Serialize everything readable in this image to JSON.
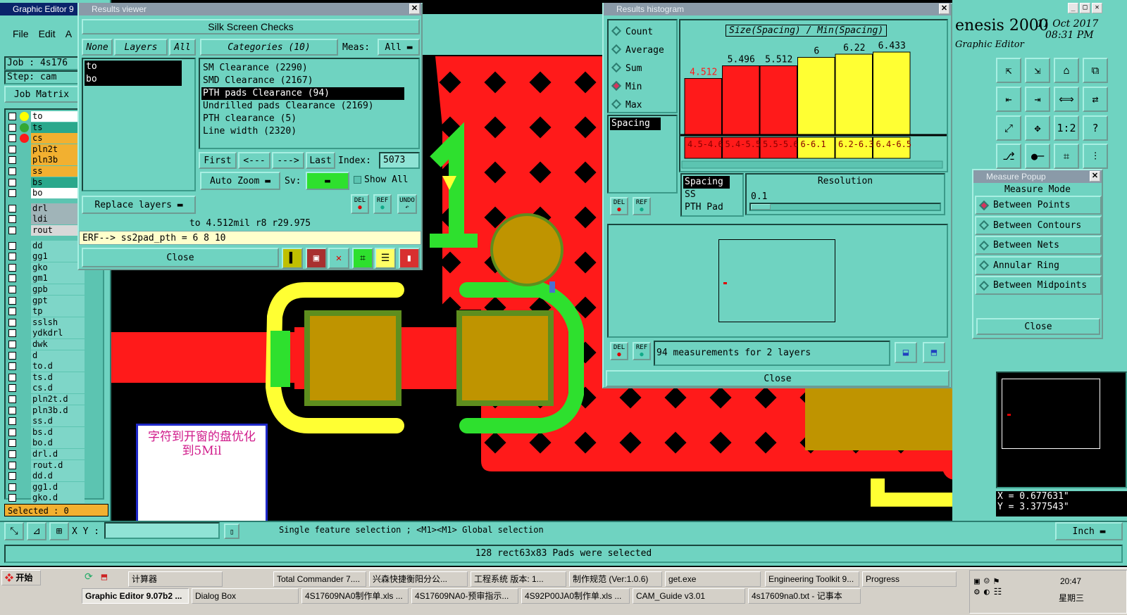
{
  "colors": {
    "panel": "#6fd3c1",
    "panel_dark": "#5cc4b1",
    "red": "#ff1a1a",
    "yellow": "#ffff33",
    "green": "#2ee02e",
    "pad": "#bf9400",
    "hist_red": "#ff1a1a",
    "hist_yellow": "#ffff33"
  },
  "main_window": {
    "title": "Graphic Editor 9",
    "menu": [
      "File",
      "Edit",
      "A"
    ],
    "job_label": "Job : 4s176",
    "step_label": "Step: cam",
    "job_matrix_button": "Job Matrix",
    "brand": "enesis 2000",
    "date": "11 Oct 2017",
    "time": "08:31 PM",
    "subtitle": "Graphic Editor",
    "selected_label": "Selected : 0",
    "xy_label": "X Y :",
    "xy_value": "",
    "status_hint": "Single feature selection ; <M1><M1> Global selection",
    "status_message": "128 rect63x83 Pads were selected",
    "units_button": "Inch",
    "coord_x": "X = 0.677631\"",
    "coord_y": "Y = 3.377543\"",
    "annotation": "字符到开窗的盘优化到5Mil"
  },
  "layers": [
    {
      "name": "to",
      "color": "#ffffff",
      "dot": "#ffff00"
    },
    {
      "name": "ts",
      "color": "#2aa88c",
      "dot": "#34a834"
    },
    {
      "name": "cs",
      "color": "#f2b030",
      "dot": "#ff1a1a"
    },
    {
      "name": "pln2t",
      "color": "#f2b030",
      "dot": ""
    },
    {
      "name": "pln3b",
      "color": "#f2b030",
      "dot": ""
    },
    {
      "name": "ss",
      "color": "#f2b030",
      "dot": ""
    },
    {
      "name": "bs",
      "color": "#2aa88c",
      "dot": ""
    },
    {
      "name": "bo",
      "color": "#ffffff",
      "dot": ""
    },
    {
      "name": "drl",
      "color": "#a0b4b8",
      "dot": ""
    },
    {
      "name": "ldi",
      "color": "#a0b4b8",
      "dot": ""
    },
    {
      "name": "rout",
      "color": "#d8d8d8",
      "dot": ""
    },
    {
      "name": "dd",
      "color": "#7ed6c8",
      "dot": ""
    },
    {
      "name": "gg1",
      "color": "#7ed6c8",
      "dot": ""
    },
    {
      "name": "gko",
      "color": "#7ed6c8",
      "dot": ""
    },
    {
      "name": "gm1",
      "color": "#7ed6c8",
      "dot": ""
    },
    {
      "name": "gpb",
      "color": "#7ed6c8",
      "dot": ""
    },
    {
      "name": "gpt",
      "color": "#7ed6c8",
      "dot": ""
    },
    {
      "name": "tp",
      "color": "#7ed6c8",
      "dot": ""
    },
    {
      "name": "sslsh",
      "color": "#7ed6c8",
      "dot": ""
    },
    {
      "name": "ydkdrl",
      "color": "#7ed6c8",
      "dot": ""
    },
    {
      "name": "dwk",
      "color": "#7ed6c8",
      "dot": ""
    },
    {
      "name": "d",
      "color": "#7ed6c8",
      "dot": ""
    },
    {
      "name": "to.d",
      "color": "#7ed6c8",
      "dot": ""
    },
    {
      "name": "ts.d",
      "color": "#7ed6c8",
      "dot": ""
    },
    {
      "name": "cs.d",
      "color": "#7ed6c8",
      "dot": ""
    },
    {
      "name": "pln2t.d",
      "color": "#7ed6c8",
      "dot": ""
    },
    {
      "name": "pln3b.d",
      "color": "#7ed6c8",
      "dot": ""
    },
    {
      "name": "ss.d",
      "color": "#7ed6c8",
      "dot": ""
    },
    {
      "name": "bs.d",
      "color": "#7ed6c8",
      "dot": ""
    },
    {
      "name": "bo.d",
      "color": "#7ed6c8",
      "dot": ""
    },
    {
      "name": "drl.d",
      "color": "#7ed6c8",
      "dot": ""
    },
    {
      "name": "rout.d",
      "color": "#7ed6c8",
      "dot": ""
    },
    {
      "name": "dd.d",
      "color": "#7ed6c8",
      "dot": ""
    },
    {
      "name": "gg1.d",
      "color": "#7ed6c8",
      "dot": ""
    },
    {
      "name": "gko.d",
      "color": "#7ed6c8",
      "dot": ""
    }
  ],
  "results_viewer": {
    "title": "Results viewer",
    "header": "Silk Screen Checks",
    "none_btn": "None",
    "layers_btn": "Layers",
    "all_btn": "All",
    "layers": [
      "to",
      "bo"
    ],
    "categories_btn": "Categories (10)",
    "meas_label": "Meas:",
    "meas_value": "All",
    "categories": [
      "SM Clearance (2290)",
      "SMD Clearance (2167)",
      "PTH pads Clearance (94)",
      "Undrilled pads Clearance (2169)",
      "PTH clearance (5)",
      "Line width (2320)"
    ],
    "selected_category": 2,
    "first": "First",
    "prev": "<---",
    "next": "--->",
    "last": "Last",
    "index_label": "Index:",
    "index_value": "5073",
    "replace_layers": "Replace layers",
    "auto_zoom": "Auto Zoom",
    "sv_label": "Sv:",
    "show_all": "Show All",
    "measurement": "to 4.512mil   r8   r29.975",
    "erf": "ERF--> ss2pad_pth = 6 8 10",
    "close": "Close",
    "del": "DEL",
    "ref": "REF",
    "undo": "UNDO"
  },
  "histogram": {
    "title": "Results histogram",
    "options": [
      {
        "label": "Count",
        "on": false
      },
      {
        "label": "Average",
        "on": false
      },
      {
        "label": "Sum",
        "on": false
      },
      {
        "label": "Min",
        "on": true
      },
      {
        "label": "Max",
        "on": false
      }
    ],
    "left_list": [
      "Spacing"
    ],
    "chart_title": "Size(Spacing) / Min(Spacing)",
    "bars": [
      {
        "label": "4.512",
        "bin": "4.5-4.6",
        "color": "#ff1a1a",
        "label_color": "#ff1a1a",
        "h": 0.53
      },
      {
        "label": "5.496",
        "bin": "5.4-5.5",
        "color": "#ff1a1a",
        "label_color": "#000",
        "h": 0.65
      },
      {
        "label": "5.512",
        "bin": "5.5-5.6",
        "color": "#ff1a1a",
        "label_color": "#000",
        "h": 0.65
      },
      {
        "label": "6",
        "bin": "6-6.1",
        "color": "#ffff33",
        "label_color": "#000",
        "h": 0.73
      },
      {
        "label": "6.22",
        "bin": "6.2-6.3",
        "color": "#ffff33",
        "label_color": "#000",
        "h": 0.76
      },
      {
        "label": "6.433",
        "bin": "6.4-6.5",
        "color": "#ffff33",
        "label_color": "#000",
        "h": 0.78
      }
    ],
    "measure_list": [
      "Spacing",
      "SS",
      "PTH Pad"
    ],
    "resolution_label": "Resolution",
    "resolution_value": "0.1",
    "summary": "94 measurements for 2 layers",
    "close": "Close",
    "del": "DEL",
    "ref": "REF"
  },
  "measure_popup": {
    "title": "Measure Popup",
    "mode_label": "Measure Mode",
    "modes": [
      {
        "label": "Between Points",
        "on": true
      },
      {
        "label": "Between Contours",
        "on": false
      },
      {
        "label": "Between Nets",
        "on": false
      },
      {
        "label": "Annular Ring",
        "on": false
      },
      {
        "label": "Between Midpoints",
        "on": false
      }
    ],
    "close": "Close"
  },
  "toolbar_icons": [
    "move-icon",
    "down-icon",
    "home-icon",
    "step-icon",
    "snap-left-icon",
    "snap-right-icon",
    "zoom-fit-icon",
    "scale-icon",
    "fit-icon",
    "pan-icon",
    "ratio-icon",
    "help-icon",
    "measure-icon",
    "probe-icon",
    "net-icon",
    "route-icon"
  ],
  "toolbar_ratio": "1:2",
  "taskbar": {
    "start": "开始",
    "row1": [
      "计算器",
      "Total Commander 7....",
      "兴森快捷衡阳分公...",
      "工程系统 版本: 1...",
      "制作规范 (Ver:1.0.6)",
      "get.exe",
      "Engineering Toolkit 9...",
      "Progress"
    ],
    "row2": [
      "Graphic Editor 9.07b2 ...",
      "Dialog Box",
      "4S17609NA0制作单.xls ...",
      "4S17609NA0-预审指示...",
      "4S92P00JA0制作单.xls ...",
      "CAM_Guide v3.01",
      "4s17609na0.txt - 记事本"
    ],
    "clock": "20:47",
    "weekday": "星期三"
  }
}
